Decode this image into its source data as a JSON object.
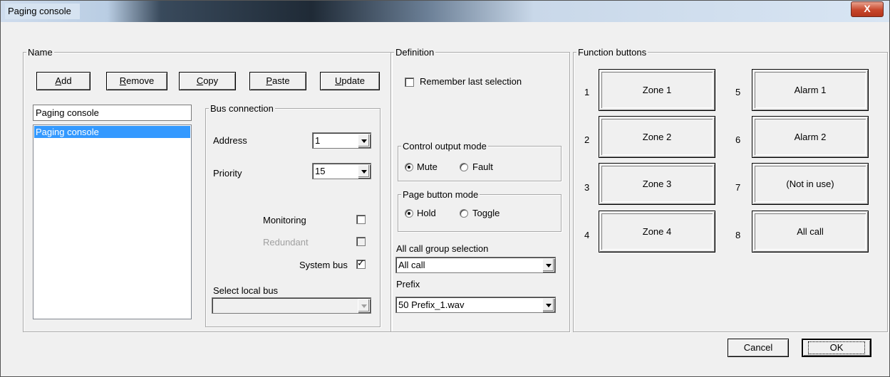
{
  "window": {
    "title": "Paging console",
    "close_glyph": "X"
  },
  "name_group": {
    "legend": "Name",
    "buttons": [
      {
        "label": "Add",
        "underline": "A"
      },
      {
        "label": "Remove",
        "underline": "R"
      },
      {
        "label": "Copy",
        "underline": "C"
      },
      {
        "label": "Paste",
        "underline": "P"
      },
      {
        "label": "Update",
        "underline": "U"
      }
    ],
    "name_value": "Paging console",
    "list_items": [
      "Paging console"
    ]
  },
  "bus_connection": {
    "legend": "Bus connection",
    "address_label": "Address",
    "address_value": "1",
    "priority_label": "Priority",
    "priority_value": "15",
    "monitoring_label": "Monitoring",
    "monitoring_checked": false,
    "redundant_label": "Redundant",
    "redundant_checked": false,
    "system_bus_label": "System bus",
    "system_bus_checked": true,
    "select_local_bus_label": "Select local bus",
    "select_local_bus_value": ""
  },
  "definition": {
    "legend": "Definition",
    "remember_label": "Remember last selection",
    "remember_checked": false,
    "control_output": {
      "legend": "Control output mode",
      "options": [
        "Mute",
        "Fault"
      ],
      "selected": "Mute"
    },
    "page_button": {
      "legend": "Page button mode",
      "options": [
        "Hold",
        "Toggle"
      ],
      "selected": "Hold"
    },
    "all_call_label": "All call group selection",
    "all_call_value": "All call",
    "prefix_label": "Prefix",
    "prefix_value": "50 Prefix_1.wav"
  },
  "function_buttons": {
    "legend": "Function buttons",
    "items": [
      {
        "num": "1",
        "label": "Zone 1"
      },
      {
        "num": "2",
        "label": "Zone 2"
      },
      {
        "num": "3",
        "label": "Zone 3"
      },
      {
        "num": "4",
        "label": "Zone 4"
      },
      {
        "num": "5",
        "label": "Alarm 1"
      },
      {
        "num": "6",
        "label": "Alarm 2"
      },
      {
        "num": "7",
        "label": "(Not in use)"
      },
      {
        "num": "8",
        "label": "All call"
      }
    ]
  },
  "footer": {
    "cancel_label": "Cancel",
    "ok_label": "OK"
  },
  "colors": {
    "close_button": "#c7472c",
    "selection": "#3399ff"
  }
}
